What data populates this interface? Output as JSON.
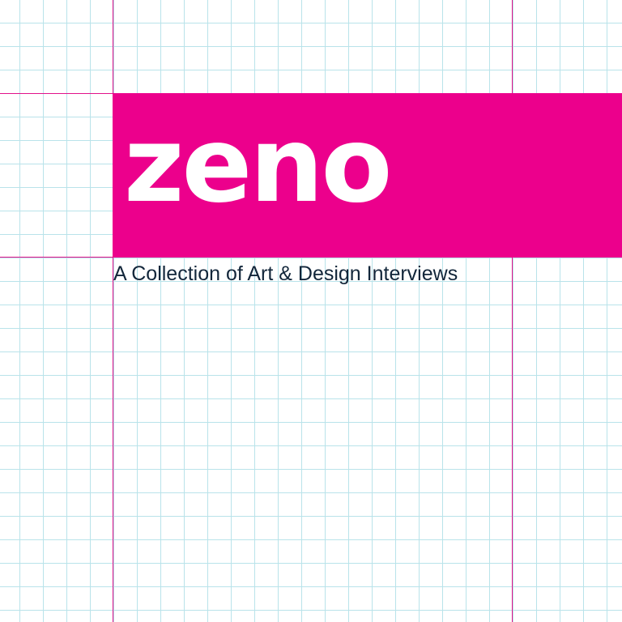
{
  "logo": {
    "brand_name": "zeno",
    "tagline": "A Collection of Art & Design Interviews"
  },
  "colors": {
    "brand_magenta": "#ec008c",
    "guide_line": "#e2118a",
    "grid_line": "#b9e3ea",
    "tagline_text": "#12263a",
    "background": "#ffffff"
  }
}
